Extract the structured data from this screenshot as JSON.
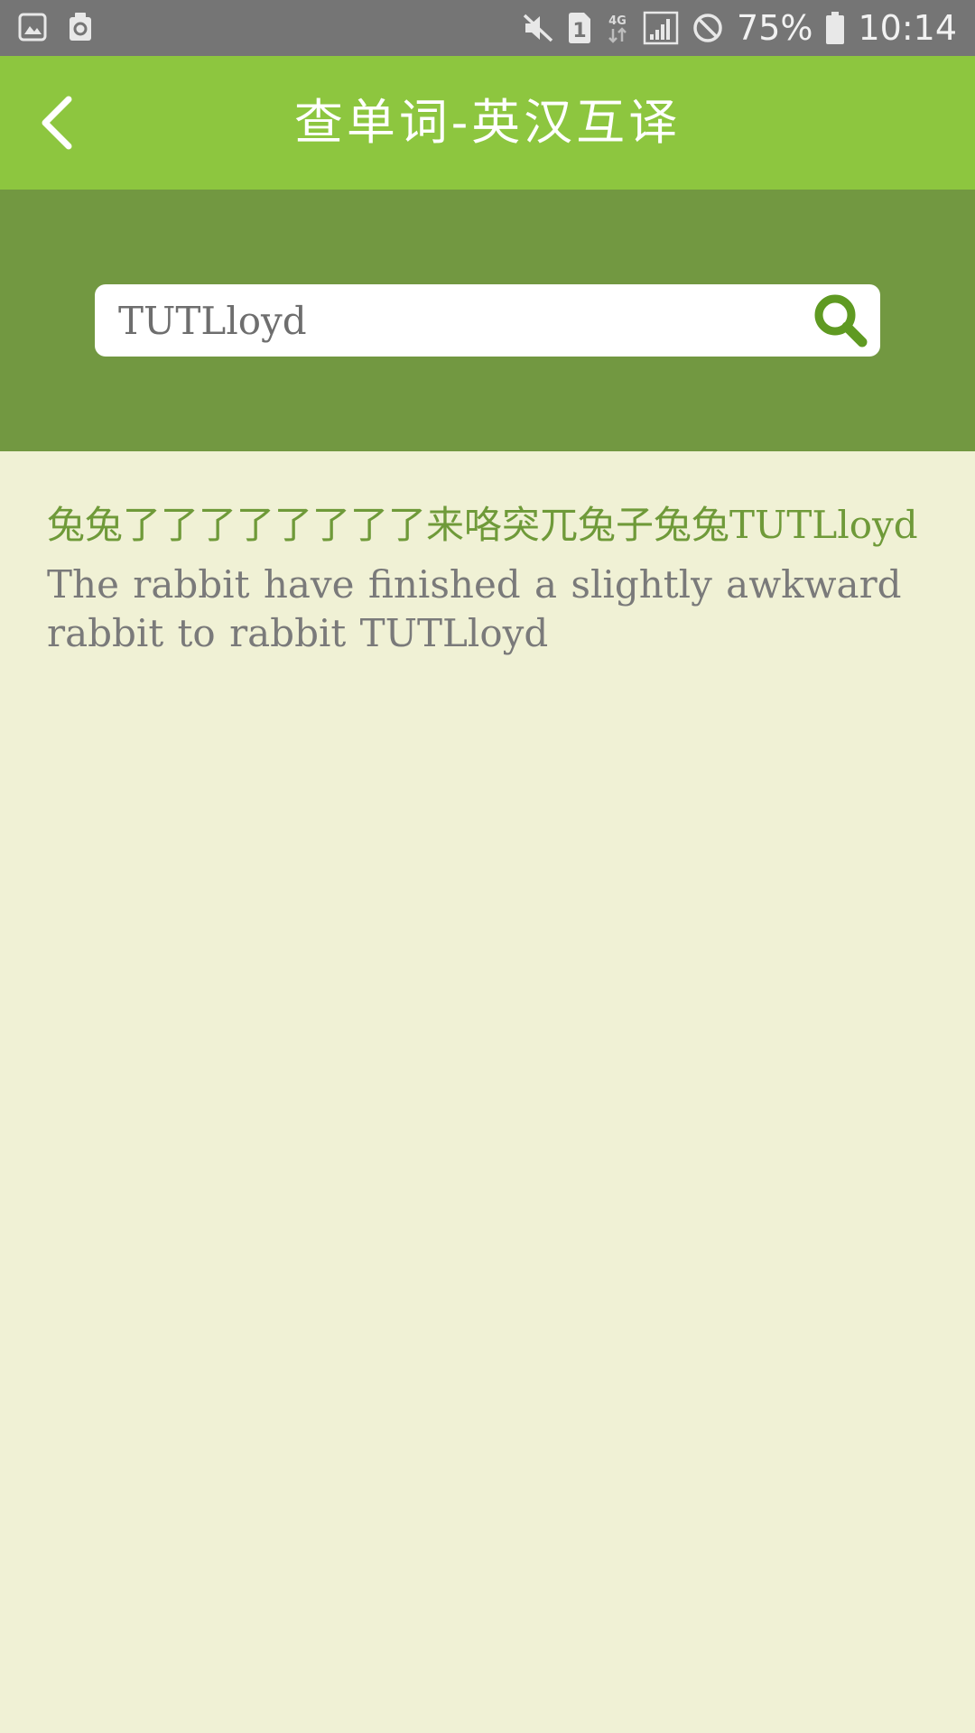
{
  "status_bar": {
    "battery_percent": "75%",
    "time": "10:14",
    "network": "4G",
    "sim": "1",
    "icons": [
      "gallery-icon",
      "storage-clean-icon",
      "mute-icon",
      "sim-icon",
      "network-4g-icon",
      "signal-icon",
      "do-not-disturb-icon",
      "battery-icon"
    ]
  },
  "header": {
    "title": "查单词-英汉互译",
    "back_icon": "back-arrow-icon"
  },
  "search": {
    "value": "TUTLloyd",
    "placeholder": "",
    "button_icon": "search-icon"
  },
  "result": {
    "headword": "兔兔了了了了了了了了来咯突兀兔子兔兔TUTLloyd",
    "translation": "The rabbit have finished a slightly awkward rabbit to rabbit TUTLloyd"
  },
  "colors": {
    "status_bar": "#757575",
    "title_bar": "#8dc63f",
    "search_band": "#729841",
    "background": "#f0f1d5",
    "headword": "#6f9a39",
    "translation": "#7a7a7a"
  }
}
